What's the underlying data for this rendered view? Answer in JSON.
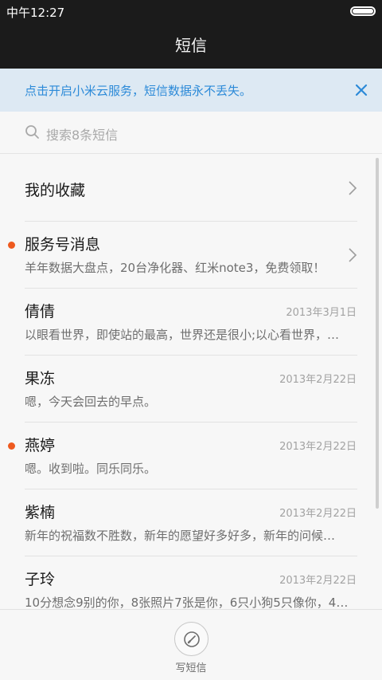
{
  "status_bar": {
    "time": "中午12:27",
    "battery_icon": "battery-icon"
  },
  "header": {
    "title": "短信"
  },
  "banner": {
    "text": "点击开启小米云服务，短信数据永不丢失。",
    "close_icon": "close-icon",
    "accent": "#2c8ad8"
  },
  "search": {
    "placeholder": "搜索8条短信",
    "icon": "search-icon"
  },
  "favorites": {
    "label": "我的收藏"
  },
  "conversations": [
    {
      "name": "服务号消息",
      "preview": "羊年数据大盘点，20台净化器、红米note3，免费领取！",
      "date": "",
      "unread": true,
      "chevron": true
    },
    {
      "name": "倩倩",
      "preview": "以眼看世界，即使站的最高，世界还是很小;以心看世界，…",
      "date": "2013年3月1日",
      "unread": false,
      "chevron": false
    },
    {
      "name": "果冻",
      "preview": "嗯，今天会回去的早点。",
      "date": "2013年2月22日",
      "unread": false,
      "chevron": false
    },
    {
      "name": "燕婷",
      "preview": "嗯。收到啦。同乐同乐。",
      "date": "2013年2月22日",
      "unread": true,
      "chevron": false
    },
    {
      "name": "紫楠",
      "preview": "新年的祝福数不胜数，新年的愿望好多好多，新年的问候…",
      "date": "2013年2月22日",
      "unread": false,
      "chevron": false
    },
    {
      "name": "子玲",
      "preview": "10分想念9别的你，8张照片7张是你，6只小狗5只像你，4…",
      "date": "2013年2月22日",
      "unread": false,
      "chevron": false
    }
  ],
  "compose": {
    "label": "写短信",
    "icon": "compose-icon"
  },
  "colors": {
    "unread_dot": "#ee5a1f",
    "header_bg": "#1b1b1b",
    "banner_bg": "#dde9f3"
  }
}
